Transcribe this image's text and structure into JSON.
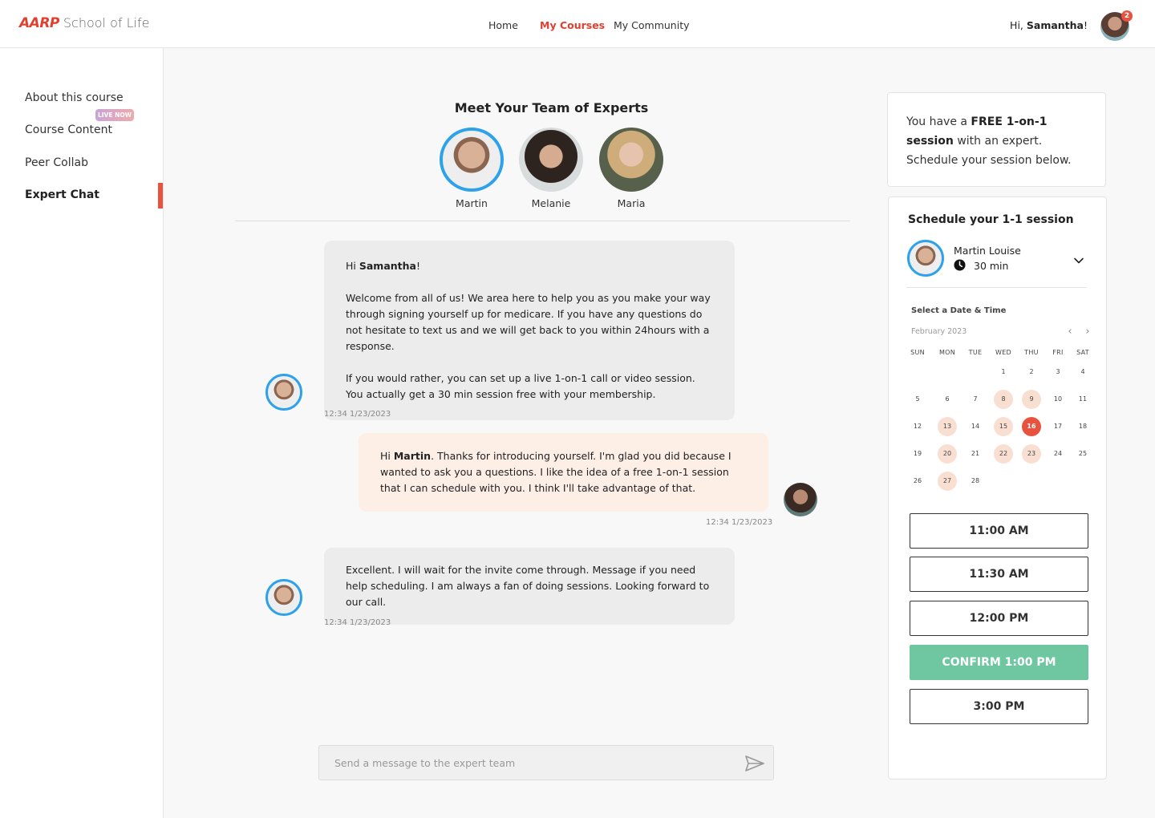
{
  "header": {
    "logo_brand": "AARP",
    "logo_text": "School of Life",
    "nav": [
      "Home",
      "My Courses",
      "My Community"
    ],
    "active_nav": "My Courses",
    "greeting_prefix": "Hi, ",
    "user_name": "Samantha",
    "greeting_suffix": "!",
    "notification_count": "2"
  },
  "sidebar": {
    "items": [
      "About this course",
      "Course Content",
      "Peer Collab",
      "Expert Chat"
    ],
    "live_badge": "LIVE NOW",
    "active_item": "Expert Chat"
  },
  "experts": {
    "title": "Meet Your Team of Experts",
    "names": [
      "Martin",
      "Melanie",
      "Maria"
    ],
    "selected": "Martin"
  },
  "chat": {
    "messages": [
      {
        "from": "expert",
        "greeting_prefix": "Hi ",
        "greeting_name": "Samantha",
        "greeting_suffix": "!",
        "p1": "Welcome from all of us! We area here to help you as you make your way through signing yourself up for medicare. If you have any questions do not hesitate to text us and we will get back to you within 24hours with a response.",
        "p2": "If you would rather, you can set up a live 1-on-1 call or video session. You actually get a 30 min session free with your membership.",
        "timestamp": "12:34 1/23/2023"
      },
      {
        "from": "user",
        "greeting_prefix": "Hi ",
        "greeting_name": "Martin",
        "text": ". Thanks for introducing yourself. I'm glad you did because I wanted to ask you a questions. I like the idea of a free 1-on-1 session that I can schedule with you. I think I'll take advantage of that.",
        "timestamp": "12:34 1/23/2023"
      },
      {
        "from": "expert",
        "text": "Excellent. I will wait for the invite come through. Message if you need help scheduling. I am always a fan of doing sessions. Looking forward to our call.",
        "timestamp": "12:34 1/23/2023"
      }
    ],
    "input_placeholder": "Send a message to the expert team"
  },
  "free_session": {
    "prefix": "You have a ",
    "bold": "FREE 1-on-1 session",
    "suffix": " with an expert.  Schedule your session below."
  },
  "schedule": {
    "title": "Schedule your 1-1 session",
    "expert_name": "Martin Louise",
    "duration": "30 min",
    "date_label": "Select a Date & Time",
    "month": "February 2023",
    "weekdays": [
      "SUN",
      "MON",
      "TUE",
      "WED",
      "THU",
      "FRI",
      "SAT"
    ],
    "days_in_month": 28,
    "first_weekday_index": 3,
    "available_days": [
      8,
      9,
      13,
      15,
      20,
      22,
      23,
      27
    ],
    "selected_day": 16,
    "time_slots": [
      "11:00 AM",
      "11:30 AM",
      "12:00 PM",
      "CONFIRM 1:00 PM",
      "3:00 PM"
    ],
    "confirm_index": 3
  },
  "colors": {
    "accent": "#e0402f",
    "expert_ring": "#2da2eb",
    "available_day": "#f9dfd1",
    "selected_day": "#e8533f",
    "confirm": "#6fc7a2",
    "user_bubble": "#fdeee6",
    "expert_bubble": "#ececec"
  }
}
